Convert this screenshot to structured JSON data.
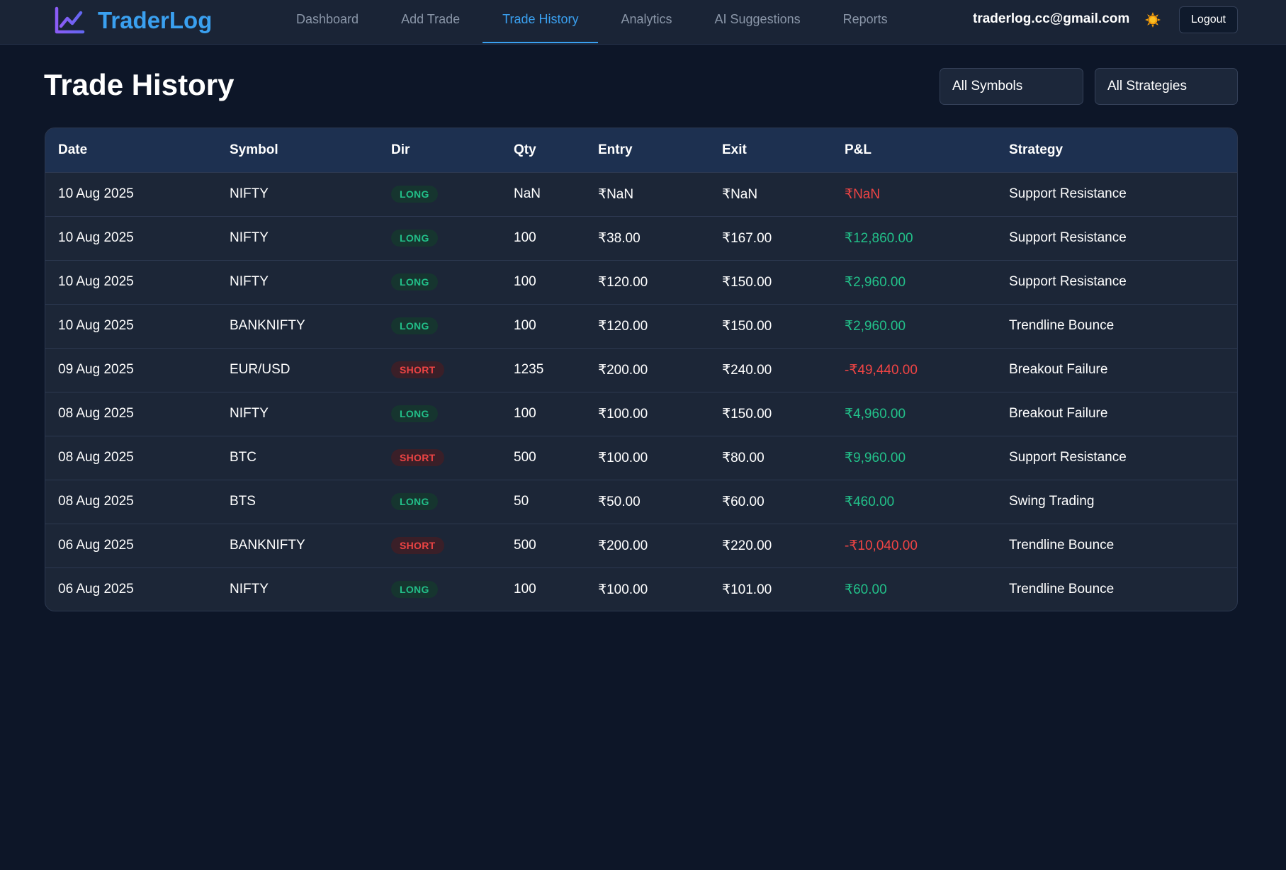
{
  "app": {
    "brand_name": "TraderLog",
    "brand_icon": "chart-line-icon",
    "accent_color": "#3aa0f0"
  },
  "nav": {
    "tabs": [
      {
        "label": "Dashboard",
        "active": false
      },
      {
        "label": "Add Trade",
        "active": false
      },
      {
        "label": "Trade History",
        "active": true
      },
      {
        "label": "Analytics",
        "active": false
      },
      {
        "label": "AI Suggestions",
        "active": false
      },
      {
        "label": "Reports",
        "active": false
      }
    ]
  },
  "user": {
    "email": "traderlog.cc@gmail.com",
    "theme_icon": "sun-icon",
    "logout_label": "Logout"
  },
  "page": {
    "title": "Trade History"
  },
  "filters": {
    "symbols_selected": "All Symbols",
    "strategies_selected": "All Strategies"
  },
  "table": {
    "columns": [
      "Date",
      "Symbol",
      "Dir",
      "Qty",
      "Entry",
      "Exit",
      "P&L",
      "Strategy"
    ],
    "rows": [
      {
        "date": "10 Aug 2025",
        "symbol": "NIFTY",
        "dir": "LONG",
        "qty": "NaN",
        "entry": "₹NaN",
        "exit": "₹NaN",
        "pnl": "₹NaN",
        "pnl_sign": "neg",
        "strategy": "Support Resistance"
      },
      {
        "date": "10 Aug 2025",
        "symbol": "NIFTY",
        "dir": "LONG",
        "qty": "100",
        "entry": "₹38.00",
        "exit": "₹167.00",
        "pnl": "₹12,860.00",
        "pnl_sign": "pos",
        "strategy": "Support Resistance"
      },
      {
        "date": "10 Aug 2025",
        "symbol": "NIFTY",
        "dir": "LONG",
        "qty": "100",
        "entry": "₹120.00",
        "exit": "₹150.00",
        "pnl": "₹2,960.00",
        "pnl_sign": "pos",
        "strategy": "Support Resistance"
      },
      {
        "date": "10 Aug 2025",
        "symbol": "BANKNIFTY",
        "dir": "LONG",
        "qty": "100",
        "entry": "₹120.00",
        "exit": "₹150.00",
        "pnl": "₹2,960.00",
        "pnl_sign": "pos",
        "strategy": "Trendline Bounce"
      },
      {
        "date": "09 Aug 2025",
        "symbol": "EUR/USD",
        "dir": "SHORT",
        "qty": "1235",
        "entry": "₹200.00",
        "exit": "₹240.00",
        "pnl": "-₹49,440.00",
        "pnl_sign": "neg",
        "strategy": "Breakout Failure"
      },
      {
        "date": "08 Aug 2025",
        "symbol": "NIFTY",
        "dir": "LONG",
        "qty": "100",
        "entry": "₹100.00",
        "exit": "₹150.00",
        "pnl": "₹4,960.00",
        "pnl_sign": "pos",
        "strategy": "Breakout Failure"
      },
      {
        "date": "08 Aug 2025",
        "symbol": "BTC",
        "dir": "SHORT",
        "qty": "500",
        "entry": "₹100.00",
        "exit": "₹80.00",
        "pnl": "₹9,960.00",
        "pnl_sign": "pos",
        "strategy": "Support Resistance"
      },
      {
        "date": "08 Aug 2025",
        "symbol": "BTS",
        "dir": "LONG",
        "qty": "50",
        "entry": "₹50.00",
        "exit": "₹60.00",
        "pnl": "₹460.00",
        "pnl_sign": "pos",
        "strategy": "Swing Trading"
      },
      {
        "date": "06 Aug 2025",
        "symbol": "BANKNIFTY",
        "dir": "SHORT",
        "qty": "500",
        "entry": "₹200.00",
        "exit": "₹220.00",
        "pnl": "-₹10,040.00",
        "pnl_sign": "neg",
        "strategy": "Trendline Bounce"
      },
      {
        "date": "06 Aug 2025",
        "symbol": "NIFTY",
        "dir": "LONG",
        "qty": "100",
        "entry": "₹100.00",
        "exit": "₹101.00",
        "pnl": "₹60.00",
        "pnl_sign": "pos",
        "strategy": "Trendline Bounce"
      }
    ]
  },
  "colors": {
    "positive": "#22c089",
    "negative": "#ef4444",
    "background": "#0d1628"
  }
}
